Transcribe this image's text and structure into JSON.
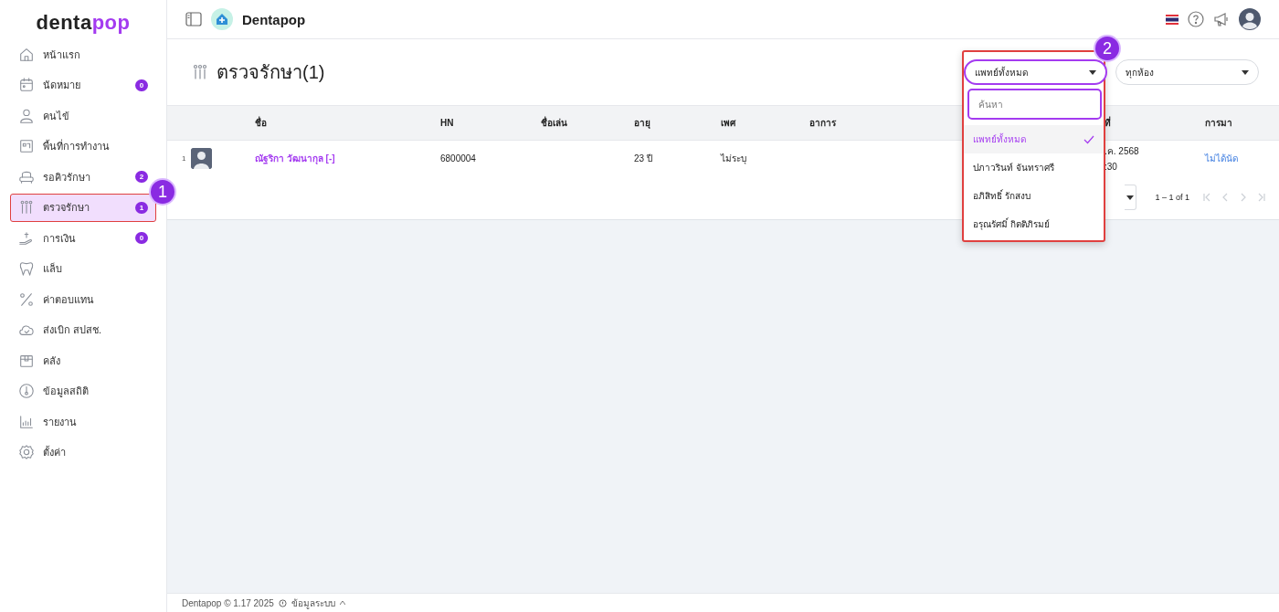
{
  "brand": {
    "logo_primary": "denta",
    "logo_accent": "pop"
  },
  "sidebar": {
    "items": [
      {
        "label": "หน้าแรก",
        "selected": false
      },
      {
        "label": "นัดหมาย",
        "badge": "0",
        "selected": false
      },
      {
        "label": "คนไข้",
        "selected": false
      },
      {
        "label": "พื้นที่การทำงาน",
        "selected": false
      },
      {
        "label": "รอคิวรักษา",
        "badge": "2",
        "selected": false
      },
      {
        "label": "ตรวจรักษา",
        "badge": "1",
        "selected": true
      },
      {
        "label": "การเงิน",
        "badge": "0",
        "selected": false
      },
      {
        "label": "แล็บ",
        "selected": false
      },
      {
        "label": "ค่าตอบแทน",
        "selected": false
      },
      {
        "label": "ส่งเบิก สปสช.",
        "selected": false
      },
      {
        "label": "คลัง",
        "selected": false
      },
      {
        "label": "ข้อมูลสถิติ",
        "selected": false
      },
      {
        "label": "รายงาน",
        "selected": false
      },
      {
        "label": "ตั้งค่า",
        "selected": false
      }
    ]
  },
  "header": {
    "title": "Dentapop"
  },
  "page": {
    "title": "ตรวจรักษา(1)"
  },
  "filters": [
    {
      "value": "แพทย์ทั้งหมด",
      "open": true
    },
    {
      "value": "ทุกห้อง",
      "open": false
    }
  ],
  "dropdown": {
    "search_placeholder": "ค้นหา",
    "options": [
      {
        "label": "แพทย์ทั้งหมด",
        "selected": true
      },
      {
        "label": "ปภาวรินท์ จันทราศรี",
        "selected": false
      },
      {
        "label": "อภิสิทธิ์ รักสงบ",
        "selected": false
      },
      {
        "label": "อรุณรัศมิ์ กิตติภิรมย์",
        "selected": false
      }
    ]
  },
  "table": {
    "columns": [
      "ชื่อ",
      "HN",
      "ชื่อเล่น",
      "อายุ",
      "เพศ",
      "อาการ",
      "ที่",
      "การมา"
    ],
    "rows": [
      {
        "index": "1",
        "name": "ณัฐริกา วัฒนากุล [-]",
        "hn": "6800004",
        "age": "23 ปี",
        "sex": "ไม่ระบุ",
        "date_lines": [
          ".ค. 2568",
          ":30"
        ],
        "visit": "ไม่ได้นัด"
      }
    ]
  },
  "pagination": {
    "range": "1 – 1 of 1"
  },
  "footer": {
    "copyright": "Dentapop © 1.17 2025",
    "link": "ข้อมูลระบบ"
  },
  "annotations": [
    {
      "label": "1"
    },
    {
      "label": "2"
    }
  ]
}
